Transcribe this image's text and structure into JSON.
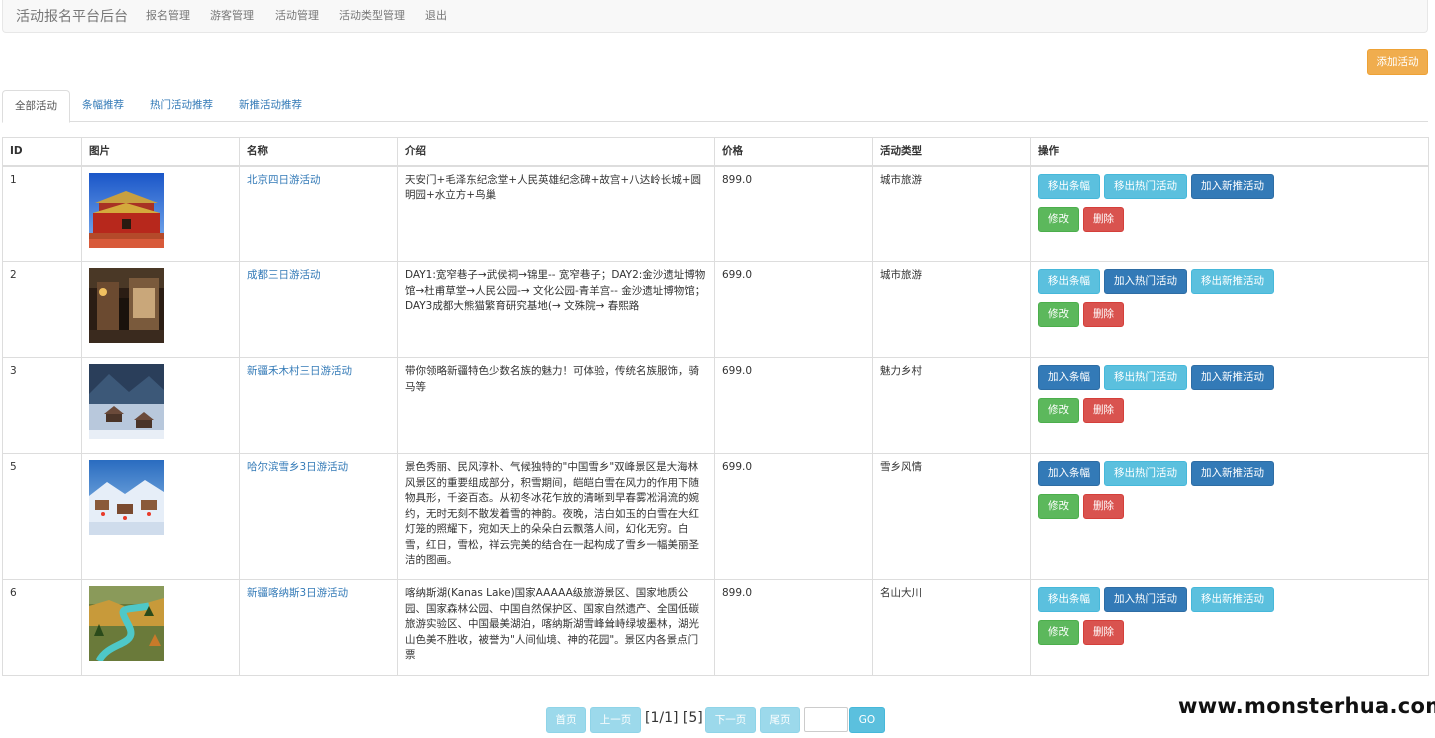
{
  "nav": {
    "brand": "活动报名平台后台",
    "items": [
      "报名管理",
      "游客管理",
      "活动管理",
      "活动类型管理",
      "退出"
    ]
  },
  "add_button": "添加活动",
  "tabs": [
    "全部活动",
    "条幅推荐",
    "热门活动推荐",
    "新推活动推荐"
  ],
  "table": {
    "headers": [
      "ID",
      "图片",
      "名称",
      "介绍",
      "价格",
      "活动类型",
      "操作"
    ],
    "rows": [
      {
        "id": "1",
        "image": "tiananmen-gate-photo",
        "name": "北京四日游活动",
        "intro": "天安门+毛泽东纪念堂+人民英雄纪念碑+故宫+八达岭长城+圆明园+水立方+鸟巢",
        "price": "899.0",
        "type": "城市旅游",
        "banner_btn": "移出条幅",
        "hot_btn": "移出热门活动",
        "new_btn": "加入新推活动",
        "edit_btn": "修改",
        "delete_btn": "删除"
      },
      {
        "id": "2",
        "image": "chengdu-street-photo",
        "name": "成都三日游活动",
        "intro": "DAY1:宽窄巷子→武侯祠→锦里-- 宽窄巷子；DAY2:金沙遗址博物馆→杜甫草堂→人民公园-→ 文化公园-青羊宫-- 金沙遗址博物馆；DAY3成都大熊猫繁育研究基地(→ 文殊院→ 春熙路",
        "price": "699.0",
        "type": "城市旅游",
        "banner_btn": "移出条幅",
        "hot_btn": "加入热门活动",
        "new_btn": "移出新推活动",
        "edit_btn": "修改",
        "delete_btn": "删除"
      },
      {
        "id": "3",
        "image": "hemu-village-photo",
        "name": "新疆禾木村三日游活动",
        "intro": "带你领略新疆特色少数名族的魅力！可体验，传统名族服饰，骑马等",
        "price": "699.0",
        "type": "魅力乡村",
        "banner_btn": "加入条幅",
        "hot_btn": "移出热门活动",
        "new_btn": "加入新推活动",
        "edit_btn": "修改",
        "delete_btn": "删除"
      },
      {
        "id": "5",
        "image": "snow-town-photo",
        "name": "哈尔滨雪乡3日游活动",
        "intro": "景色秀丽、民风淳朴、气候独特的\"中国雪乡\"双峰景区是大海林风景区的重要组成部分，积雪期间，皑皑白雪在风力的作用下随物具形，千姿百态。从初冬冰花乍放的清晰到早春雾凇涓流的婉约，无时无刻不散发着雪的神韵。夜晚，洁白如玉的白雪在大红灯笼的照耀下，宛如天上的朵朵白云飘落人间，幻化无穷。白雪，红日，雪松，祥云完美的结合在一起构成了雪乡一幅美丽圣洁的图画。",
        "price": "699.0",
        "type": "雪乡风情",
        "banner_btn": "加入条幅",
        "hot_btn": "移出热门活动",
        "new_btn": "加入新推活动",
        "edit_btn": "修改",
        "delete_btn": "删除"
      },
      {
        "id": "6",
        "image": "kanas-lake-photo",
        "name": "新疆喀纳斯3日游活动",
        "intro": "喀纳斯湖(Kanas Lake)国家AAAAA级旅游景区、国家地质公园、国家森林公园、中国自然保护区、国家自然遗产、全国低碳旅游实验区、中国最美湖泊，喀纳斯湖雪峰耸峙绿坡墨林，湖光山色美不胜收，被誉为\"人间仙境、神的花园\"。景区内各景点门票",
        "price": "899.0",
        "type": "名山大川",
        "banner_btn": "移出条幅",
        "hot_btn": "加入热门活动",
        "new_btn": "移出新推活动",
        "edit_btn": "修改",
        "delete_btn": "删除"
      }
    ]
  },
  "pager": {
    "first": "首页",
    "prev": "上一页",
    "info": "[1/1] [5]",
    "next": "下一页",
    "last": "尾页",
    "go": "GO"
  },
  "watermark": "www.monsterhua.com"
}
